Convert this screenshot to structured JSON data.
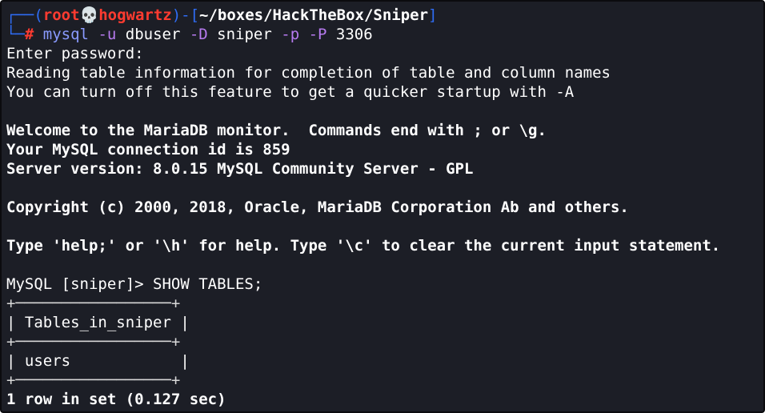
{
  "prompt": {
    "frame_top": "┌──(",
    "user": "root",
    "skull": "💀",
    "host": "hogwartz",
    "frame_mid": ")-[",
    "path": "~/boxes/HackTheBox/Sniper",
    "frame_end": "]",
    "frame_bottom": "└─",
    "hash": "#",
    "command": "mysql",
    "args": [
      {
        "text": " -u",
        "kind": "flag"
      },
      {
        "text": " dbuser",
        "kind": "plain"
      },
      {
        "text": " -D",
        "kind": "flag"
      },
      {
        "text": " sniper",
        "kind": "plain"
      },
      {
        "text": " -p",
        "kind": "flag"
      },
      {
        "text": " -P",
        "kind": "flag"
      },
      {
        "text": " 3306",
        "kind": "plain"
      }
    ]
  },
  "output": {
    "enter_password": "Enter password:",
    "reading_info": "Reading table information for completion of table and column names",
    "quicker_startup": "You can turn off this feature to get a quicker startup with -A",
    "welcome": "Welcome to the MariaDB monitor.  Commands end with ; or \\g.",
    "connection_id": "Your MySQL connection id is 859",
    "server_version": "Server version: 8.0.15 MySQL Community Server - GPL",
    "copyright": "Copyright (c) 2000, 2018, Oracle, MariaDB Corporation Ab and others.",
    "help_hint": "Type 'help;' or '\\h' for help. Type '\\c' to clear the current input statement.",
    "mysql_prompt": "MySQL [sniper]> SHOW TABLES;",
    "table_border": "+─────────────────+",
    "table_header": "| Tables_in_sniper |",
    "table_row": "| users            |",
    "row_count": "1 row in set (0.127 sec)"
  },
  "colors": {
    "background": "#1c1e26",
    "frame": "#2f6df6",
    "root": "#ff3b30",
    "command": "#8a9bff",
    "flag": "#b77bf0"
  }
}
